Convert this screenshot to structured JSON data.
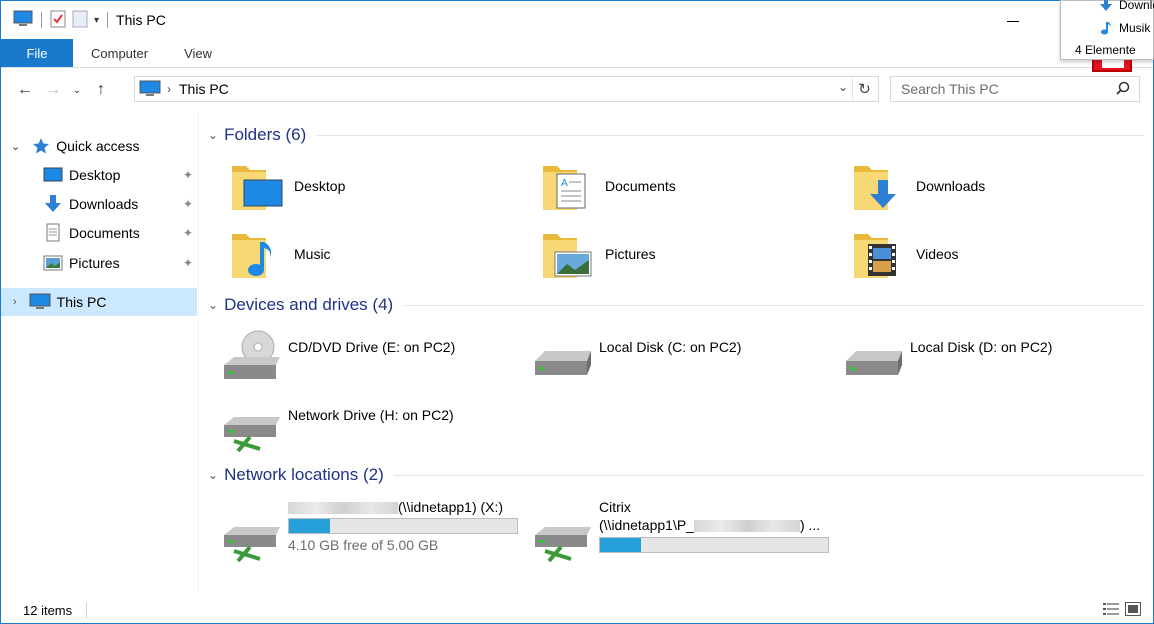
{
  "window": {
    "title": "This PC"
  },
  "ribbon": {
    "tabs": [
      "File",
      "Computer",
      "View"
    ]
  },
  "address": {
    "path": "This PC",
    "search_placeholder": "Search This PC"
  },
  "nav": {
    "quick_access": "Quick access",
    "items": [
      {
        "label": "Desktop",
        "icon": "desktop-icon"
      },
      {
        "label": "Downloads",
        "icon": "downloads-icon"
      },
      {
        "label": "Documents",
        "icon": "documents-icon"
      },
      {
        "label": "Pictures",
        "icon": "pictures-icon"
      }
    ],
    "this_pc": "This PC"
  },
  "groups": {
    "folders": "Folders (6)",
    "devices": "Devices and drives (4)",
    "network": "Network locations (2)"
  },
  "folders": [
    "Desktop",
    "Documents",
    "Downloads",
    "Music",
    "Pictures",
    "Videos"
  ],
  "drives": [
    {
      "name": "CD/DVD Drive (E: on PC2)"
    },
    {
      "name": "Local Disk (C: on PC2)"
    },
    {
      "name": "Local Disk (D: on PC2)"
    },
    {
      "name": "Network Drive (H: on PC2)"
    }
  ],
  "network_locations": [
    {
      "name_suffix": "(\\\\idnetapp1) (X:)",
      "free": "4.10 GB free of 5.00 GB",
      "usage_fraction": 0.18
    },
    {
      "line1": "Citrix",
      "line2_prefix": "(\\\\idnetapp1\\P_",
      "line2_suffix": ") ...",
      "usage_fraction": 0.18
    }
  ],
  "status": {
    "count": "12 items"
  },
  "popup": {
    "items": [
      {
        "label": "Downlo",
        "icon": "downloads-icon"
      },
      {
        "label": "Musik",
        "icon": "music-note-icon"
      }
    ],
    "footer": "4 Elemente"
  },
  "colors": {
    "accent": "#1979ca",
    "header": "#1e3287",
    "selection": "#cce8ff",
    "progress": "#26a0da",
    "folder": "#f8d775"
  }
}
